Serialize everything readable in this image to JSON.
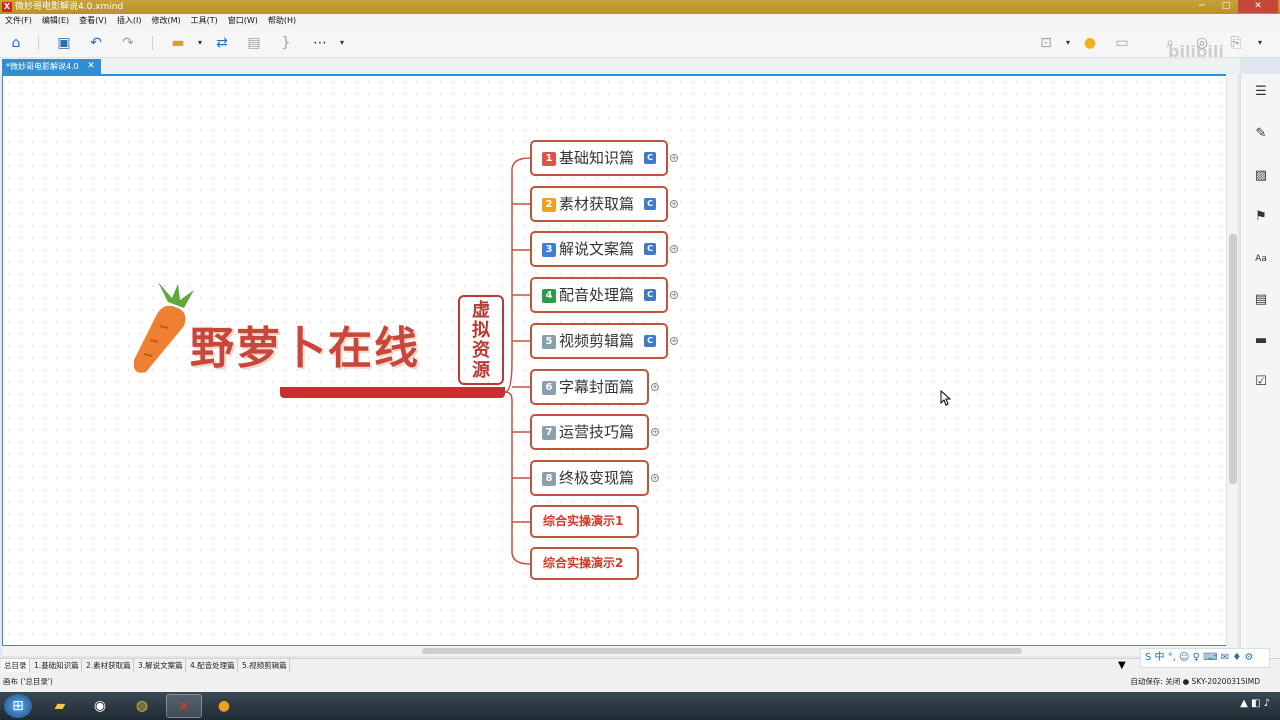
{
  "window": {
    "title": "微妙哥电影解说4.0.xmind",
    "app_icon": "X"
  },
  "menu": [
    "文件(F)",
    "编辑(E)",
    "查看(V)",
    "插入(I)",
    "修改(M)",
    "工具(T)",
    "窗口(W)",
    "帮助(H)"
  ],
  "toolbar": {
    "icons": [
      "home-icon",
      "save-icon",
      "undo-icon",
      "redo-icon",
      "topic-icon",
      "relationship-icon",
      "boundary-icon",
      "summary-icon",
      "more-icon"
    ]
  },
  "tab": {
    "label": "*微妙哥电影解说4.0",
    "close": "✕"
  },
  "central": {
    "logo_text": "野萝卜在线",
    "stamp_text": [
      "虚",
      "拟",
      "资",
      "源"
    ]
  },
  "topics": [
    {
      "num": "1",
      "label": "基础知识篇",
      "color": "#e0524a",
      "note": true
    },
    {
      "num": "2",
      "label": "素材获取篇",
      "color": "#f0a020",
      "note": true
    },
    {
      "num": "3",
      "label": "解说文案篇",
      "color": "#3d7fd8",
      "note": true
    },
    {
      "num": "4",
      "label": "配音处理篇",
      "color": "#2a9c4a",
      "note": true
    },
    {
      "num": "5",
      "label": "视频剪辑篇",
      "color": "#8aa0ad",
      "note": true
    },
    {
      "num": "6",
      "label": "字幕封面篇",
      "color": "#8aa0ad",
      "note": false
    },
    {
      "num": "7",
      "label": "运营技巧篇",
      "color": "#8aa0ad",
      "note": false
    },
    {
      "num": "8",
      "label": "终极变现篇",
      "color": "#8aa0ad",
      "note": false
    }
  ],
  "extra_topics": [
    "综合实操演示1",
    "综合实操演示2"
  ],
  "note_letter": "C",
  "plus_symbol": "+",
  "sheets": [
    "总目录",
    "1.基础知识篇",
    "2.素材获取篇",
    "3.解说文案篇",
    "4.配音处理篇",
    "5.视频剪辑篇"
  ],
  "status": {
    "left": "画布 ('总目录')",
    "right": "自动保存: 关闭  ●  SKY-20200315IMD"
  },
  "ime": "S 中 °, ☺ ♀ ⌨ ✉ ♦ ⚙",
  "watermark": "bilibili"
}
